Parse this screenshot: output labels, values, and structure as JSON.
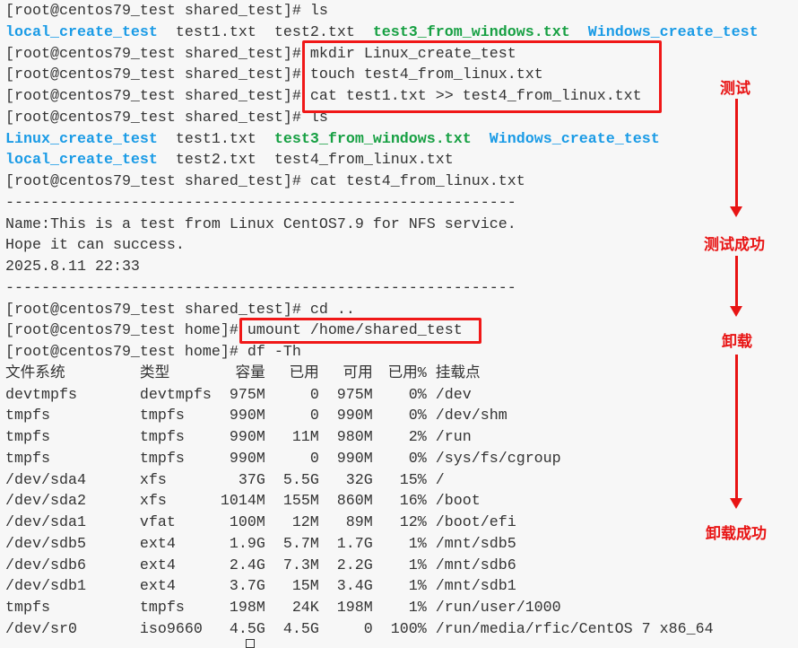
{
  "terminal": {
    "lines": [
      [
        {
          "t": "[root@centos79_test shared_test]# "
        },
        {
          "t": "ls"
        }
      ],
      [
        {
          "t": "local_create_test",
          "c": "blue"
        },
        {
          "t": "  test1.txt  test2.txt  "
        },
        {
          "t": "test3_from_windows.txt",
          "c": "green"
        },
        {
          "t": "  "
        },
        {
          "t": "Windows_create_test",
          "c": "blue"
        }
      ],
      [
        {
          "t": "[root@centos79_test shared_test]# "
        },
        {
          "t": "mkdir Linux_create_test"
        }
      ],
      [
        {
          "t": "[root@centos79_test shared_test]# "
        },
        {
          "t": "touch test4_from_linux.txt"
        }
      ],
      [
        {
          "t": "[root@centos79_test shared_test]# "
        },
        {
          "t": "cat test1.txt >> test4_from_linux.txt"
        }
      ],
      [
        {
          "t": "[root@centos79_test shared_test]# "
        },
        {
          "t": "ls"
        }
      ],
      [
        {
          "t": "Linux_create_test",
          "c": "blue"
        },
        {
          "t": "  test1.txt  "
        },
        {
          "t": "test3_from_windows.txt",
          "c": "green"
        },
        {
          "t": "  "
        },
        {
          "t": "Windows_create_test",
          "c": "blue"
        }
      ],
      [
        {
          "t": "local_create_test",
          "c": "blue"
        },
        {
          "t": "  test2.txt  test4_from_linux.txt"
        }
      ],
      [
        {
          "t": "[root@centos79_test shared_test]# "
        },
        {
          "t": "cat test4_from_linux.txt"
        }
      ],
      [
        {
          "t": "---------------------------------------------------------"
        }
      ],
      [
        {
          "t": "Name:This is a test from Linux CentOS7.9 for NFS service."
        }
      ],
      [
        {
          "t": "Hope it can success."
        }
      ],
      [
        {
          "t": "2025.8.11 22:33"
        }
      ],
      [
        {
          "t": "---------------------------------------------------------"
        }
      ],
      [
        {
          "t": "[root@centos79_test shared_test]# "
        },
        {
          "t": "cd .."
        }
      ],
      [
        {
          "t": "[root@centos79_test home]# "
        },
        {
          "t": "umount /home/shared_test"
        }
      ],
      [
        {
          "t": "[root@centos79_test home]# "
        },
        {
          "t": "df -Th"
        }
      ]
    ],
    "df": {
      "header": [
        "文件系统",
        "类型",
        "容量",
        "已用",
        "可用",
        "已用%",
        "挂载点"
      ],
      "rows": [
        [
          "devtmpfs",
          "devtmpfs",
          "975M",
          "0",
          "975M",
          "0%",
          "/dev"
        ],
        [
          "tmpfs",
          "tmpfs",
          "990M",
          "0",
          "990M",
          "0%",
          "/dev/shm"
        ],
        [
          "tmpfs",
          "tmpfs",
          "990M",
          "11M",
          "980M",
          "2%",
          "/run"
        ],
        [
          "tmpfs",
          "tmpfs",
          "990M",
          "0",
          "990M",
          "0%",
          "/sys/fs/cgroup"
        ],
        [
          "/dev/sda4",
          "xfs",
          "37G",
          "5.5G",
          "32G",
          "15%",
          "/"
        ],
        [
          "/dev/sda2",
          "xfs",
          "1014M",
          "155M",
          "860M",
          "16%",
          "/boot"
        ],
        [
          "/dev/sda1",
          "vfat",
          "100M",
          "12M",
          "89M",
          "12%",
          "/boot/efi"
        ],
        [
          "/dev/sdb5",
          "ext4",
          "1.9G",
          "5.7M",
          "1.7G",
          "1%",
          "/mnt/sdb5"
        ],
        [
          "/dev/sdb6",
          "ext4",
          "2.4G",
          "7.3M",
          "2.2G",
          "1%",
          "/mnt/sdb6"
        ],
        [
          "/dev/sdb1",
          "ext4",
          "3.7G",
          "15M",
          "3.4G",
          "1%",
          "/mnt/sdb1"
        ],
        [
          "tmpfs",
          "tmpfs",
          "198M",
          "24K",
          "198M",
          "1%",
          "/run/user/1000"
        ],
        [
          "/dev/sr0",
          "iso9660",
          "4.5G",
          "4.5G",
          "0",
          "100%",
          "/run/media/rfic/CentOS 7 x86_64"
        ]
      ]
    }
  },
  "annotations": {
    "test": "测试",
    "test_success": "测试成功",
    "unmount": "卸载",
    "unmount_success": "卸载成功"
  },
  "colors": {
    "highlight": "#f01818",
    "blue": "#1a9be6",
    "green": "#17a043"
  }
}
